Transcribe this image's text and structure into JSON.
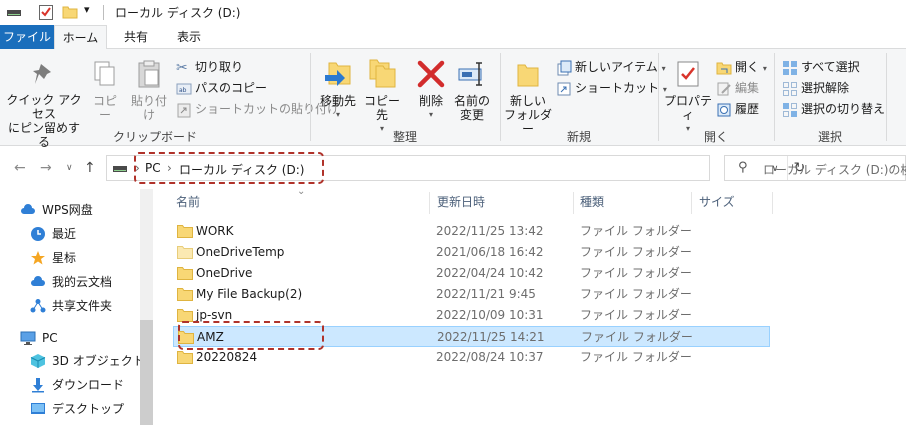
{
  "window": {
    "title": "ローカル ディスク (D:)"
  },
  "tabs": {
    "file": "ファイル",
    "home": "ホーム",
    "share": "共有",
    "view": "表示"
  },
  "ribbon": {
    "clipboard": {
      "pin_l1": "クイック アクセス",
      "pin_l2": "にピン留めする",
      "copy": "コピー",
      "paste": "貼り付け",
      "cut": "切り取り",
      "copy_path": "パスのコピー",
      "paste_shortcut": "ショートカットの貼り付け",
      "label": "クリップボード"
    },
    "organize": {
      "move_to": "移動先",
      "copy_to": "コピー先",
      "delete": "削除",
      "rename_l1": "名前の",
      "rename_l2": "変更",
      "label": "整理"
    },
    "new": {
      "new_folder_l1": "新しい",
      "new_folder_l2": "フォルダー",
      "new_item": "新しいアイテム",
      "easy_access": "ショートカット",
      "label": "新規"
    },
    "open": {
      "properties": "プロパティ",
      "open": "開く",
      "edit": "編集",
      "history": "履歴",
      "label": "開く"
    },
    "select": {
      "select_all": "すべて選択",
      "select_none": "選択解除",
      "invert": "選択の切り替え",
      "label": "選択"
    }
  },
  "address": {
    "crumbs": [
      "PC",
      "ローカル ディスク (D:)"
    ],
    "separator": "›",
    "search_placeholder": "ローカル ディスク (D:)の検索"
  },
  "nav_pane": [
    {
      "label": "WPS网盘",
      "icon": "cloud-icon"
    },
    {
      "label": "最近",
      "icon": "clock-icon"
    },
    {
      "label": "星标",
      "icon": "star-icon"
    },
    {
      "label": "我的云文档",
      "icon": "cloud-doc-icon"
    },
    {
      "label": "共享文件夹",
      "icon": "share-icon"
    },
    {
      "label": "PC",
      "icon": "pc-icon"
    },
    {
      "label": "3D オブジェクト",
      "icon": "cube-icon"
    },
    {
      "label": "ダウンロード",
      "icon": "download-icon"
    },
    {
      "label": "デスクトップ",
      "icon": "desktop-icon"
    }
  ],
  "columns": {
    "name": "名前",
    "date": "更新日時",
    "type": "種類",
    "size": "サイズ"
  },
  "files": [
    {
      "name": "WORK",
      "date": "2022/11/25 13:42",
      "type": "ファイル フォルダー",
      "selected": false
    },
    {
      "name": "OneDriveTemp",
      "date": "2021/06/18 16:42",
      "type": "ファイル フォルダー",
      "selected": false
    },
    {
      "name": "OneDrive",
      "date": "2022/04/24 10:42",
      "type": "ファイル フォルダー",
      "selected": false
    },
    {
      "name": "My File Backup(2)",
      "date": "2022/11/21 9:45",
      "type": "ファイル フォルダー",
      "selected": false
    },
    {
      "name": "jp-svn",
      "date": "2022/10/09 10:31",
      "type": "ファイル フォルダー",
      "selected": false
    },
    {
      "name": "AMZ",
      "date": "2022/11/25 14:21",
      "type": "ファイル フォルダー",
      "selected": true
    },
    {
      "name": "20220824",
      "date": "2022/08/24 10:37",
      "type": "ファイル フォルダー",
      "selected": false
    }
  ],
  "colors": {
    "accent": "#1a6ebc",
    "selection": "#cce8ff",
    "highlight_dash": "#b0322a",
    "folder": "#f8d775"
  }
}
